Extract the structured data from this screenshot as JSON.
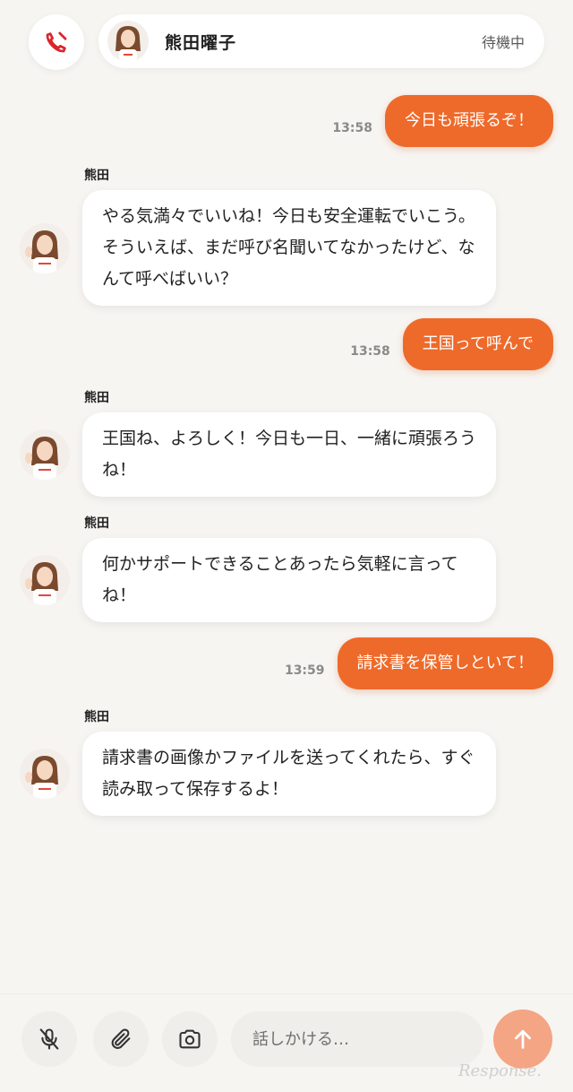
{
  "header": {
    "name": "熊田曜子",
    "status": "待機中"
  },
  "messages": [
    {
      "role": "user",
      "time": "13:58",
      "text": "今日も頑張るぞ！"
    },
    {
      "role": "bot",
      "sender": "熊田",
      "text": "やる気満々でいいね！今日も安全運転でいこう。そういえば、まだ呼び名聞いてなかったけど、なんて呼べばいい？"
    },
    {
      "role": "user",
      "time": "13:58",
      "text": "王国って呼んで"
    },
    {
      "role": "bot",
      "sender": "熊田",
      "text": "王国ね、よろしく！今日も一日、一緒に頑張ろうね！"
    },
    {
      "role": "bot",
      "sender": "熊田",
      "text": "何かサポートできることあったら気軽に言ってね！"
    },
    {
      "role": "user",
      "time": "13:59",
      "text": "請求書を保管しといて！"
    },
    {
      "role": "bot",
      "sender": "熊田",
      "text": "請求書の画像かファイルを送ってくれたら、すぐ読み取って保存するよ！"
    }
  ],
  "input": {
    "placeholder": "話しかける…"
  },
  "icons": {
    "end_call": "phone-off-icon",
    "mic": "mic-off-icon",
    "attach": "paperclip-icon",
    "camera": "camera-icon",
    "send": "arrow-up-icon"
  },
  "colors": {
    "accent": "#ee6a2a",
    "send_button": "#f4a583",
    "end_call_icon": "#d9262b",
    "background": "#f7f5f2"
  },
  "watermark": "Response."
}
